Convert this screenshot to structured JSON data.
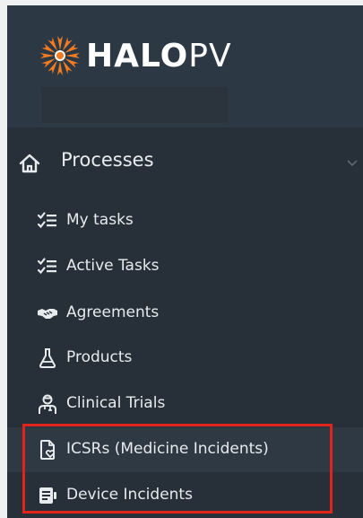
{
  "brand": {
    "name_bold": "HALO",
    "name_thin": "PV",
    "accent_color": "#f47b20"
  },
  "nav": {
    "section": {
      "title": "Processes",
      "icon": "home-icon",
      "expand_icon": "chevron-down-icon"
    },
    "items": [
      {
        "label": "My tasks",
        "icon": "checklist-icon"
      },
      {
        "label": "Active Tasks",
        "icon": "checklist-icon"
      },
      {
        "label": "Agreements",
        "icon": "handshake-icon"
      },
      {
        "label": "Products",
        "icon": "flask-icon"
      },
      {
        "label": "Clinical Trials",
        "icon": "clinician-icon"
      },
      {
        "label": "ICSRs (Medicine Incidents)",
        "icon": "document-heart-icon"
      },
      {
        "label": "Device Incidents",
        "icon": "device-icon"
      }
    ]
  },
  "annotation": {
    "highlight_color": "#e2231a"
  }
}
